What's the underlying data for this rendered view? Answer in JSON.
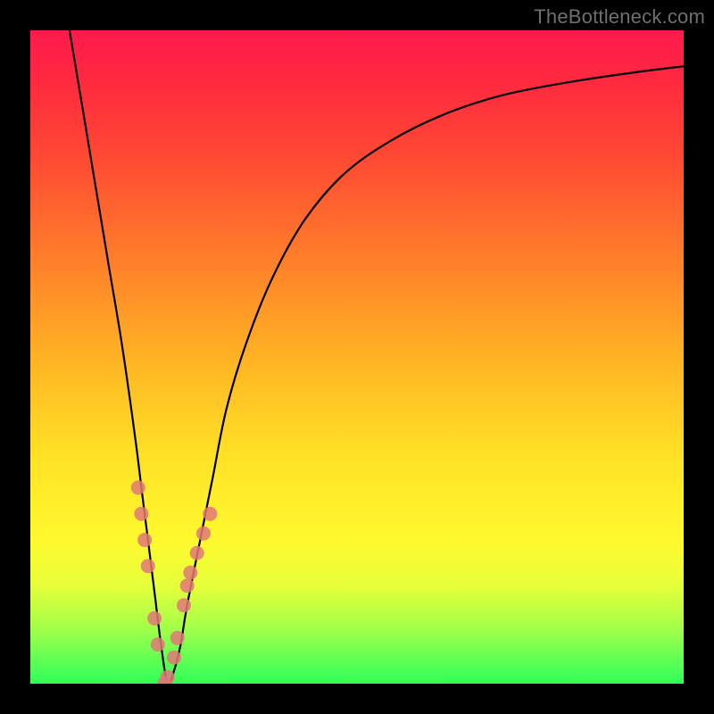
{
  "watermark": "TheBottleneck.com",
  "colors": {
    "frame": "#000000",
    "curve": "#000000",
    "markers": "#e07878",
    "gradient_stops": [
      "#ff1a4d",
      "#ff2a3f",
      "#ff4b33",
      "#ff7e2a",
      "#ffb224",
      "#ffe126",
      "#fff92e",
      "#e6ff3a",
      "#9dff4a",
      "#2eff5c"
    ]
  },
  "chart_data": {
    "type": "line",
    "title": "",
    "xlabel": "",
    "ylabel": "",
    "xlim": [
      0,
      100
    ],
    "ylim": [
      0,
      100
    ],
    "series": [
      {
        "name": "bottleneck-curve",
        "x": [
          6,
          8,
          10,
          12,
          14,
          16,
          17,
          18,
          19,
          20,
          21,
          22,
          23,
          24,
          26,
          28,
          30,
          33,
          37,
          42,
          48,
          55,
          63,
          72,
          82,
          92,
          100
        ],
        "values": [
          100,
          88,
          76,
          64,
          52,
          38,
          30,
          22,
          14,
          6,
          0,
          2,
          6,
          12,
          22,
          32,
          42,
          52,
          62,
          71,
          78,
          83,
          87,
          90,
          92,
          93.5,
          94.5
        ]
      }
    ],
    "markers": {
      "name": "observed-points",
      "x": [
        16.5,
        17.0,
        17.5,
        18.0,
        19.0,
        19.5,
        20.5,
        21.0,
        22.0,
        22.5,
        23.5,
        24.0,
        24.5,
        25.5,
        26.5,
        27.5
      ],
      "values": [
        30,
        26,
        22,
        18,
        10,
        6,
        0,
        1,
        4,
        7,
        12,
        15,
        17,
        20,
        23,
        26
      ]
    }
  }
}
